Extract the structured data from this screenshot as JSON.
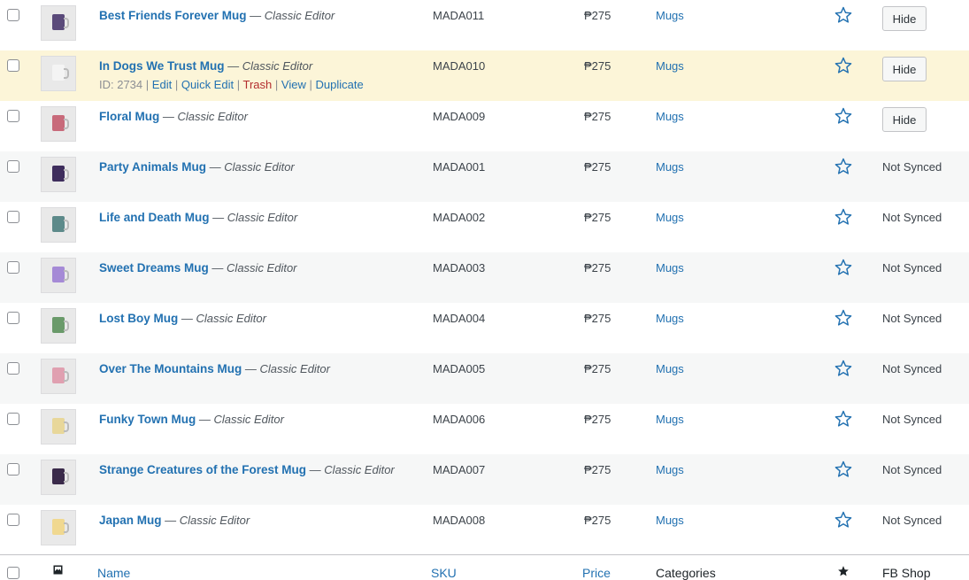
{
  "products": [
    {
      "name": "Best Friends Forever Mug",
      "sep": "—",
      "editor": "Classic Editor",
      "sku": "MADA011",
      "price": "₱275",
      "category": "Mugs",
      "sync": "Hide",
      "sync_type": "button",
      "mug_color": "#5a4a7a"
    },
    {
      "name": "In Dogs We Trust Mug",
      "sep": "—",
      "editor": "Classic Editor",
      "sku": "MADA010",
      "price": "₱275",
      "category": "Mugs",
      "sync": "Hide",
      "sync_type": "button",
      "mug_color": "#f4f4f4"
    },
    {
      "name": "Floral Mug",
      "sep": "—",
      "editor": "Classic Editor",
      "sku": "MADA009",
      "price": "₱275",
      "category": "Mugs",
      "sync": "Hide",
      "sync_type": "button",
      "mug_color": "#c86a7a"
    },
    {
      "name": "Party Animals Mug",
      "sep": "—",
      "editor": "Classic Editor",
      "sku": "MADA001",
      "price": "₱275",
      "category": "Mugs",
      "sync": "Not Synced",
      "sync_type": "text",
      "mug_color": "#3e2d5c"
    },
    {
      "name": "Life and Death Mug",
      "sep": "—",
      "editor": "Classic Editor",
      "sku": "MADA002",
      "price": "₱275",
      "category": "Mugs",
      "sync": "Not Synced",
      "sync_type": "text",
      "mug_color": "#5d8a8a"
    },
    {
      "name": "Sweet Dreams Mug",
      "sep": "—",
      "editor": "Classic Editor",
      "sku": "MADA003",
      "price": "₱275",
      "category": "Mugs",
      "sync": "Not Synced",
      "sync_type": "text",
      "mug_color": "#a58ad6"
    },
    {
      "name": "Lost Boy Mug",
      "sep": "—",
      "editor": "Classic Editor",
      "sku": "MADA004",
      "price": "₱275",
      "category": "Mugs",
      "sync": "Not Synced",
      "sync_type": "text",
      "mug_color": "#6a9a6a"
    },
    {
      "name": "Over The Mountains Mug",
      "sep": "—",
      "editor": "Classic Editor",
      "sku": "MADA005",
      "price": "₱275",
      "category": "Mugs",
      "sync": "Not Synced",
      "sync_type": "text",
      "mug_color": "#e0a0b0"
    },
    {
      "name": "Funky Town Mug",
      "sep": "—",
      "editor": "Classic Editor",
      "sku": "MADA006",
      "price": "₱275",
      "category": "Mugs",
      "sync": "Not Synced",
      "sync_type": "text",
      "mug_color": "#e8d79a"
    },
    {
      "name": "Strange Creatures of the Forest Mug",
      "sep": "—",
      "editor": "Classic Editor",
      "sku": "MADA007",
      "price": "₱275",
      "category": "Mugs",
      "sync": "Not Synced",
      "sync_type": "text",
      "mug_color": "#3a2a4a"
    },
    {
      "name": "Japan Mug",
      "sep": "—",
      "editor": "Classic Editor",
      "sku": "MADA008",
      "price": "₱275",
      "category": "Mugs",
      "sync": "Not Synced",
      "sync_type": "text",
      "mug_color": "#f0d890"
    }
  ],
  "hover_actions": {
    "row": 1,
    "id_label": "ID: 2734",
    "edit": "Edit",
    "quick_edit": "Quick Edit",
    "trash": "Trash",
    "view": "View",
    "duplicate": "Duplicate",
    "sep": "|"
  },
  "footer": {
    "name": "Name",
    "sku": "SKU",
    "price": "Price",
    "categories": "Categories",
    "fb_shop": "FB Shop",
    "thumb_icon": "image-icon",
    "featured_icon": "star-filled-icon"
  },
  "colors": {
    "link": "#2271b1",
    "trash": "#b32d2e",
    "highlight": "#fcf5d8",
    "alt_row": "#f6f7f7"
  }
}
